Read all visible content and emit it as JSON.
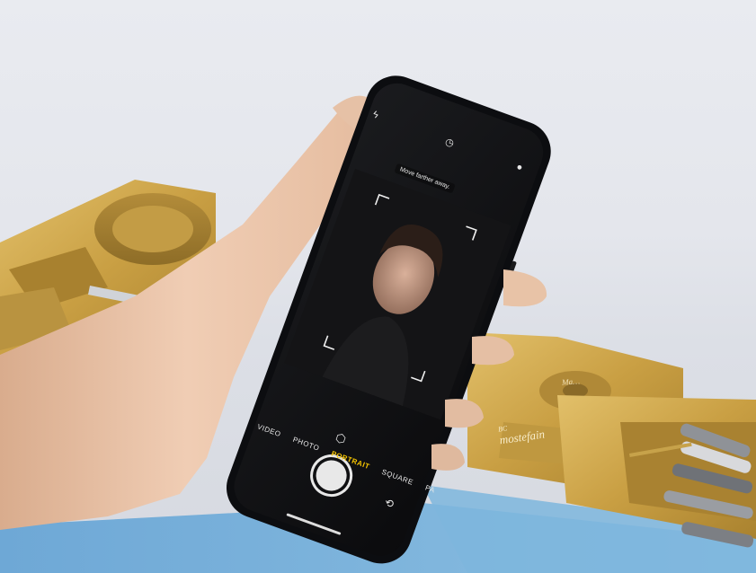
{
  "scene": {
    "description_hidden": "",
    "colors": {
      "background": "#e6e8ee",
      "mat_blue": "#7fb3d9",
      "gold": "#c9a24a",
      "phone_body": "#0e0f12",
      "screen": "#111214",
      "skin": "#e9c3a8",
      "accent_yellow": "#f5c400"
    }
  },
  "camera_ui": {
    "hint": "Move farther away.",
    "icons": [
      "flash-icon",
      "timer-icon",
      "filter-icon",
      "lighting-cube-icon",
      "switch-camera-icon"
    ],
    "modes": [
      "VIDEO",
      "PHOTO",
      "PORTRAIT",
      "SQUARE",
      "PA"
    ],
    "active_mode": "PORTRAIT"
  },
  "tool_text": {
    "brand": "mostefain",
    "brand_top": "BC",
    "plate_label": "Ma…"
  }
}
